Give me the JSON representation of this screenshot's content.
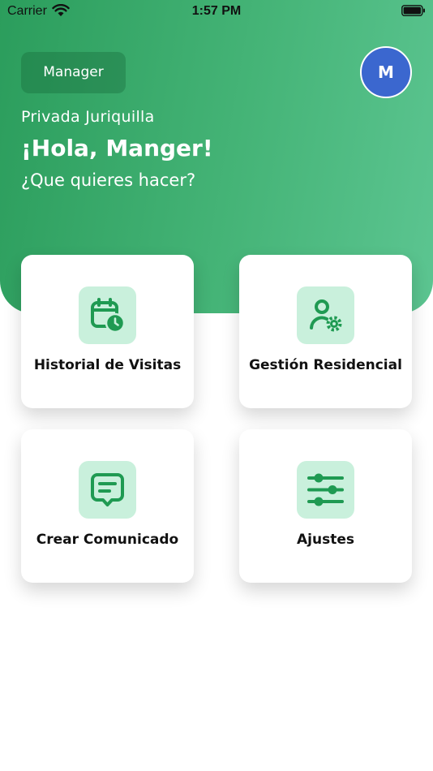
{
  "status_bar": {
    "carrier": "Carrier",
    "time": "1:57 PM"
  },
  "header": {
    "role_badge": "Manager",
    "avatar_initial": "M",
    "site_name": "Privada Juriquilla",
    "greeting": "¡Hola, Manger!",
    "prompt": "¿Que quieres hacer?"
  },
  "cards": [
    {
      "label": "Historial de Visitas",
      "icon": "calendar-clock-icon"
    },
    {
      "label": "Gestión Residencial",
      "icon": "user-gear-icon"
    },
    {
      "label": "Crear Comunicado",
      "icon": "message-icon"
    },
    {
      "label": "Ajustes",
      "icon": "sliders-icon"
    }
  ],
  "colors": {
    "gradient_start": "#2b9d5c",
    "gradient_end": "#5cc591",
    "icon_green": "#1f9a52",
    "icon_bg": "#c9f0dc",
    "avatar_blue": "#3b67cf"
  }
}
